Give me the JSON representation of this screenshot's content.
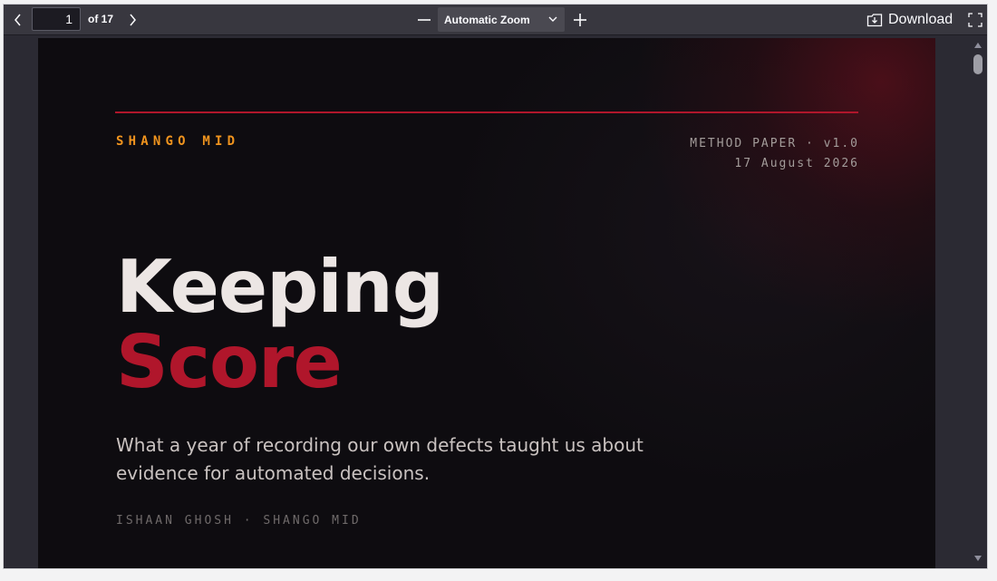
{
  "toolbar": {
    "current_page": "1",
    "page_count_label": "of 17",
    "zoom_label": "Automatic Zoom",
    "download_label": "Download",
    "icons": {
      "prev": "chevron-left-icon",
      "next": "chevron-right-icon",
      "zoom_out": "minus-icon",
      "zoom_in": "plus-icon",
      "zoom_dropdown": "chevron-down-icon",
      "download": "download-icon",
      "fullscreen": "fullscreen-icon"
    }
  },
  "document": {
    "brand": "SHANGO MID",
    "doc_type": "METHOD PAPER · v1.0",
    "date": "17 August 2026",
    "title_line1": "Keeping",
    "title_line2": "Score",
    "subtitle": "What a year of recording our own defects taught us about evidence for automated decisions.",
    "byline": "ISHAAN GHOSH  ·  SHANGO MID"
  },
  "colors": {
    "accent_red": "#b0162b",
    "brand_orange": "#f0941e",
    "page_background": "#0e0c10",
    "toolbar_background": "#38373f"
  }
}
